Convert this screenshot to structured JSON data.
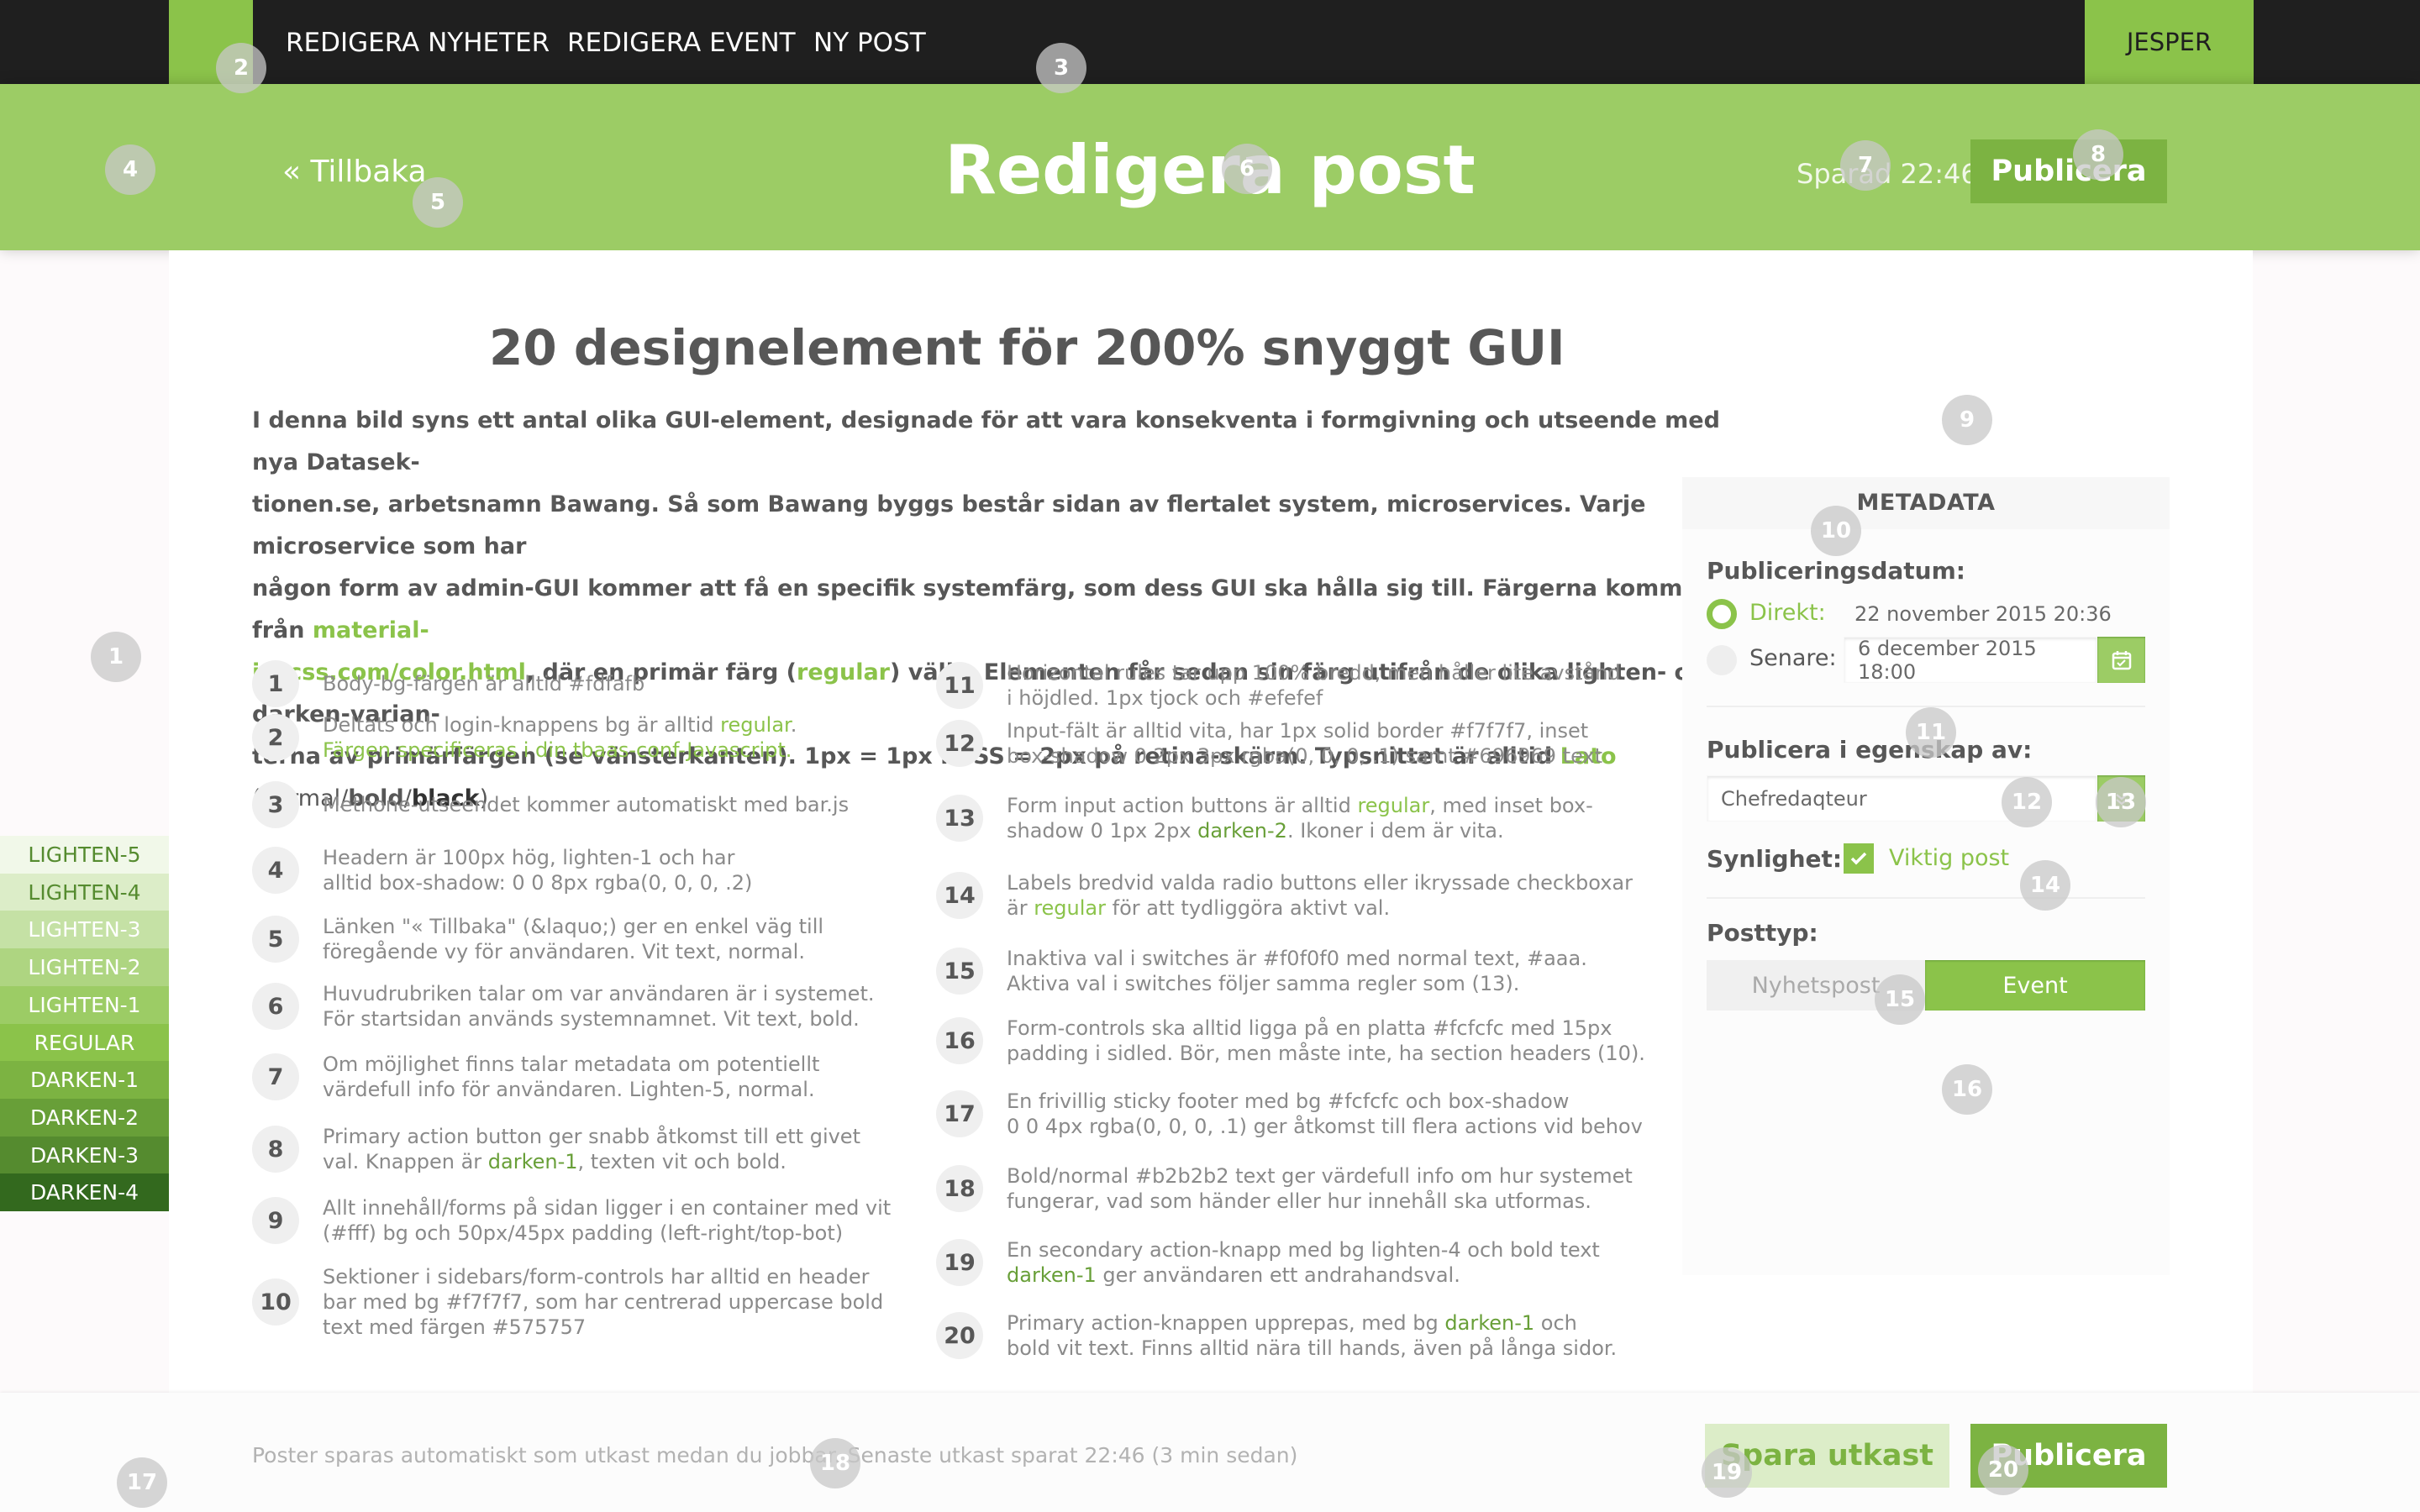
{
  "nav": {
    "items": [
      "REDIGERA NYHETER",
      "REDIGERA EVENT",
      "NY POST"
    ],
    "user": "JESPER"
  },
  "header": {
    "back": "« Tillbaka",
    "title": "Redigera post",
    "saved": "Sparad 22:46",
    "publish": "Publicera"
  },
  "article": {
    "title": "20 designelement för 200% snyggt GUI",
    "intro": {
      "line1": "I denna bild syns ett antal olika GUI-element, designade för att vara konsekventa i formgivning och utseende med nya Datasek-",
      "line2": "tionen.se, arbetsnamn Bawang. Så som Bawang byggs består sidan av flertalet system, microservices. Varje microservice som har",
      "line3": "någon form av admin-GUI kommer att få en specifik systemfärg, som dess GUI ska hålla sig till. Färgerna kommer från ",
      "link1a": "material-",
      "link1b": "izecss.com/color.html",
      "line4a": ", där en primär färg (",
      "link2": "regular",
      "line4b": ") väljs. Elementen får sedan sin färg utifrån de olika lighten- och darken-varian-",
      "line5a": "terna av primärfärgen (se vänsterkanten). 1px = 1px i CSS = 2px på retina-skärm. Typsnittet är alltid ",
      "link3": "Lato",
      "line5b": " (normal/",
      "bold": "bold",
      "slash": "/",
      "black": "black",
      "close": ")"
    }
  },
  "items": [
    {
      "n": "1",
      "a": "Body-bg-färgen är alltid #fdfafb"
    },
    {
      "n": "2",
      "a": "Deltats och login-knappens bg är alltid ",
      "a_hl": "regular",
      "a_end": ".",
      "b_hl": "Färgen specificeras i din tbaas-conf-Javascript."
    },
    {
      "n": "3",
      "a": "Methone-utseendet kommer automatiskt med bar.js"
    },
    {
      "n": "4",
      "a": "Headern är 100px hög, lighten-1 och har",
      "b": "alltid box-shadow: 0 0 8px rgba(0, 0, 0, .2)"
    },
    {
      "n": "5",
      "a": "Länken \"« Tillbaka\" (&laquo;) ger en enkel väg till",
      "b": "föregående vy för användaren. Vit text, normal."
    },
    {
      "n": "6",
      "a": "Huvudrubriken talar om var användaren är i systemet.",
      "b": "För startsidan används systemnamnet. Vit text, bold."
    },
    {
      "n": "7",
      "a": "Om möjlighet finns talar metadata om potentiellt",
      "b": "värdefull info för användaren. Lighten-5, normal."
    },
    {
      "n": "8",
      "a": "Primary action button ger snabb åtkomst till ett givet",
      "b": "val. Knappen är ",
      "b_hl": "darken-1",
      "b_end": ", texten vit och bold."
    },
    {
      "n": "9",
      "a": "Allt innehåll/forms på sidan ligger i en container med vit",
      "b": "(#fff) bg och 50px/45px padding (left-right/top-bot)"
    },
    {
      "n": "10",
      "a": "Sektioner i sidebars/form-controls har alltid en header",
      "b": "bar med bg #f7f7f7, som har centrerad uppercase bold",
      "c": "text med färgen #575757"
    },
    {
      "n": "11",
      "a": "Horizontal rules tar upp 100% bredd, men håller lite avstånd",
      "b": "i höjdled. 1px tjock och #efefef"
    },
    {
      "n": "12",
      "a": "Input-fält är alltid vita, har 1px solid border #f7f7f7, inset",
      "b": "box-shadow 0 2px 3px rgba(0, 0, 0, .1) samt #696969 text"
    },
    {
      "n": "13",
      "a": "Form input action buttons är alltid ",
      "a_hl": "regular",
      "a_end": ", med inset box-",
      "b": "shadow 0 1px 2px ",
      "b_hl": "darken-2",
      "b_end": ". Ikoner i dem är vita."
    },
    {
      "n": "14",
      "a": "Labels bredvid valda radio buttons eller ikryssade checkboxar",
      "b": "är ",
      "b_hl": "regular",
      "b_end": " för att tydliggöra aktivt val."
    },
    {
      "n": "15",
      "a": "Inaktiva val i switches är #f0f0f0 med normal text, #aaa.",
      "b": "Aktiva val i switches följer samma regler som (13)."
    },
    {
      "n": "16",
      "a": "Form-controls ska alltid ligga på en platta #fcfcfc med 15px",
      "b": "padding i sidled. Bör, men måste inte, ha section headers (10)."
    },
    {
      "n": "17",
      "a": "En frivillig sticky footer med bg #fcfcfc och box-shadow",
      "b": "0 0 4px rgba(0, 0, 0, .1) ger åtkomst till flera actions vid behov"
    },
    {
      "n": "18",
      "a": "Bold/normal #b2b2b2 text ger värdefull info om hur systemet",
      "b": "fungerar, vad som händer eller hur innehåll ska utformas."
    },
    {
      "n": "19",
      "a": "En secondary action-knapp med bg lighten-4 och bold text",
      "b_hl": "darken-1",
      "b_end": " ger användaren ett andrahandsval."
    },
    {
      "n": "20",
      "a": "Primary action-knappen upprepas, med bg ",
      "a_hl": "darken-1",
      "a_end": " och",
      "b": "bold vit text. Finns alltid nära till hands, även på långa sidor."
    }
  ],
  "meta": {
    "header": "METADATA",
    "pubdate_label": "Publiceringsdatum:",
    "direct": "Direkt:",
    "direct_value": "22 november 2015 20:36",
    "later": "Senare:",
    "later_value": "6 december 2015 18:00",
    "role_label": "Publicera i egenskap av:",
    "role_value": "Chefredaqteur",
    "vis_label": "Synlighet:",
    "vis_check": "Viktig post",
    "type_label": "Posttyp:",
    "type_news": "Nyhetspost",
    "type_event": "Event"
  },
  "footer": {
    "text1": "Poster sparas automatiskt som utkast medan du jobbar. ",
    "text2": "Senaste utkast sparat 22:46 (3 min sedan)",
    "save_draft": "Spara utkast",
    "publish": "Publicera"
  },
  "palette": [
    {
      "label": "LIGHTEN-5",
      "bg": "#f1f8e9",
      "fg": "#558b2f"
    },
    {
      "label": "LIGHTEN-4",
      "bg": "#dcedc8",
      "fg": "#558b2f"
    },
    {
      "label": "LIGHTEN-3",
      "bg": "#c5e1a5",
      "fg": "#ffffff"
    },
    {
      "label": "LIGHTEN-2",
      "bg": "#aed581",
      "fg": "#ffffff"
    },
    {
      "label": "LIGHTEN-1",
      "bg": "#9ccc65",
      "fg": "#ffffff"
    },
    {
      "label": "REGULAR",
      "bg": "#8bc34a",
      "fg": "#ffffff"
    },
    {
      "label": "DARKEN-1",
      "bg": "#7cb342",
      "fg": "#ffffff"
    },
    {
      "label": "DARKEN-2",
      "bg": "#689f38",
      "fg": "#ffffff"
    },
    {
      "label": "DARKEN-3",
      "bg": "#558b2f",
      "fg": "#ffffff"
    },
    {
      "label": "DARKEN-4",
      "bg": "#33691e",
      "fg": "#ffffff"
    }
  ],
  "bubbles": [
    "1",
    "2",
    "3",
    "4",
    "5",
    "6",
    "7",
    "8",
    "9",
    "10",
    "11",
    "12",
    "13",
    "14",
    "15",
    "16",
    "17",
    "18",
    "19",
    "20"
  ]
}
